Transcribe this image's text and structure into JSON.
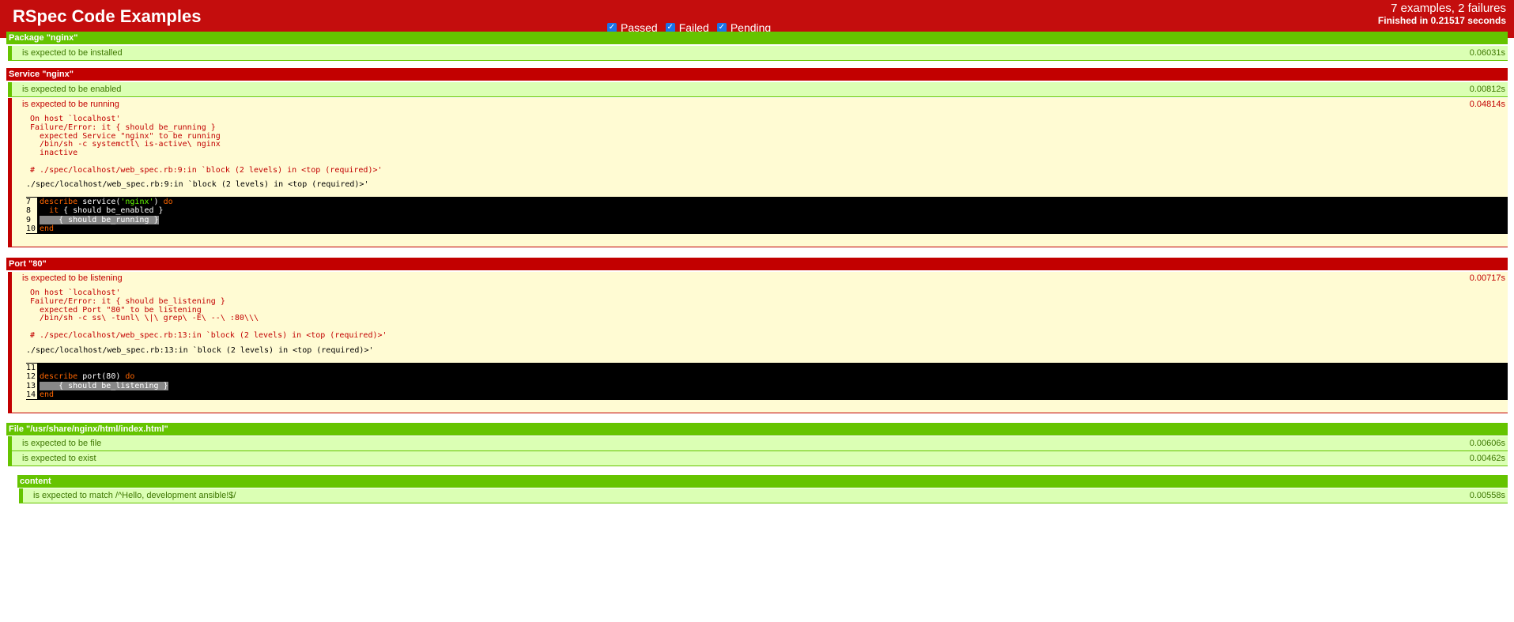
{
  "header": {
    "title": "RSpec Code Examples",
    "filters": [
      {
        "label": "Passed",
        "checked": true
      },
      {
        "label": "Failed",
        "checked": true
      },
      {
        "label": "Pending",
        "checked": true
      }
    ],
    "summary": "7 examples, 2 failures",
    "finished_prefix": "Finished in ",
    "finished_time": "0.21517 seconds"
  },
  "groups": [
    {
      "title": "Package \"nginx\"",
      "status": "passed",
      "examples": [
        {
          "desc": "is expected to be installed",
          "time": "0.06031s",
          "status": "passed"
        }
      ]
    },
    {
      "title": "Service \"nginx\"",
      "status": "failed",
      "examples": [
        {
          "desc": "is expected to be enabled",
          "time": "0.00812s",
          "status": "passed"
        },
        {
          "desc": "is expected to be running",
          "time": "0.04814s",
          "status": "failed",
          "message": "On host `localhost'\nFailure/Error: it { should be_running }\n  expected Service \"nginx\" to be running\n  /bin/sh -c systemctl\\ is-active\\ nginx\n  inactive\n\n# ./spec/localhost/web_spec.rb:9:in `block (2 levels) in <top (required)>'",
          "backtrace": "./spec/localhost/web_spec.rb:9:in `block (2 levels) in <top (required)>'",
          "code": [
            {
              "no": "7",
              "parts": [
                [
                  "kw",
                  "describe"
                ],
                [
                  "",
                  " service("
                ],
                [
                  "str",
                  "'nginx'"
                ],
                [
                  "",
                  ") "
                ],
                [
                  "kw",
                  "do"
                ]
              ]
            },
            {
              "no": "8",
              "parts": [
                [
                  "",
                  "  "
                ],
                [
                  "kw",
                  "it"
                ],
                [
                  "",
                  " { should be_enabled }"
                ]
              ]
            },
            {
              "no": "9",
              "parts": [
                [
                  "hl",
                  "    { should be_running }"
                ]
              ]
            },
            {
              "no": "10",
              "parts": [
                [
                  "kw",
                  "end"
                ]
              ]
            }
          ]
        }
      ]
    },
    {
      "title": "Port \"80\"",
      "status": "failed",
      "examples": [
        {
          "desc": "is expected to be listening",
          "time": "0.00717s",
          "status": "failed",
          "message": "On host `localhost'\nFailure/Error: it { should be_listening }\n  expected Port \"80\" to be listening\n  /bin/sh -c ss\\ -tunl\\ \\|\\ grep\\ -E\\ --\\ :80\\\\\\\n\n# ./spec/localhost/web_spec.rb:13:in `block (2 levels) in <top (required)>'",
          "backtrace": "./spec/localhost/web_spec.rb:13:in `block (2 levels) in <top (required)>'",
          "code": [
            {
              "no": "11",
              "parts": [
                [
                  "",
                  ""
                ]
              ]
            },
            {
              "no": "12",
              "parts": [
                [
                  "kw",
                  "describe"
                ],
                [
                  "",
                  " port(80) "
                ],
                [
                  "kw",
                  "do"
                ]
              ]
            },
            {
              "no": "13",
              "parts": [
                [
                  "hl",
                  "    { should be_listening }"
                ]
              ]
            },
            {
              "no": "14",
              "parts": [
                [
                  "kw",
                  "end"
                ]
              ]
            }
          ]
        }
      ]
    },
    {
      "title": "File \"/usr/share/nginx/html/index.html\"",
      "status": "passed",
      "examples": [
        {
          "desc": "is expected to be file",
          "time": "0.00606s",
          "status": "passed"
        },
        {
          "desc": "is expected to exist",
          "time": "0.00462s",
          "status": "passed"
        }
      ]
    },
    {
      "title": "content",
      "status": "passed",
      "examples": [
        {
          "desc": "is expected to match /^Hello, development ansible!$/",
          "time": "0.00558s",
          "status": "passed"
        }
      ]
    }
  ]
}
